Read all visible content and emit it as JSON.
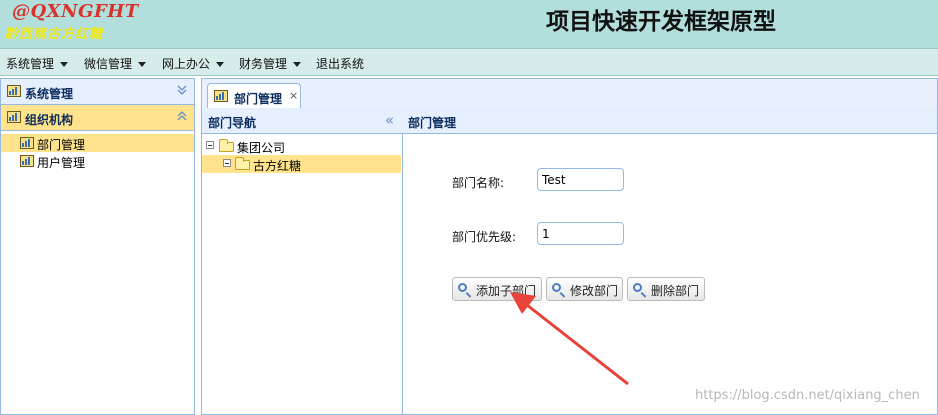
{
  "header": {
    "logo_line1": "@QXNGFHT",
    "logo_line2": "黔西南古方红糖",
    "title": "项目快速开发框架原型"
  },
  "menu": {
    "items": [
      {
        "label": "系统管理",
        "has_dropdown": true
      },
      {
        "label": "微信管理",
        "has_dropdown": true
      },
      {
        "label": "网上办公",
        "has_dropdown": true
      },
      {
        "label": "财务管理",
        "has_dropdown": true
      },
      {
        "label": "退出系统",
        "has_dropdown": false
      }
    ]
  },
  "sidebar": {
    "sections": [
      {
        "title": "系统管理",
        "expanded": false
      },
      {
        "title": "组织机构",
        "expanded": true
      }
    ],
    "items": [
      {
        "label": "部门管理",
        "selected": true
      },
      {
        "label": "用户管理",
        "selected": false
      }
    ]
  },
  "tabs": [
    {
      "label": "部门管理",
      "close": "×"
    }
  ],
  "nav": {
    "title": "部门导航",
    "collapse_glyph": "«",
    "tree": [
      {
        "label": "集团公司",
        "selected": false
      },
      {
        "label": "古方红糖",
        "selected": true
      }
    ]
  },
  "detail": {
    "title": "部门管理",
    "name_label": "部门名称:",
    "name_value": "Test",
    "priority_label": "部门优先级:",
    "priority_value": "1",
    "buttons": {
      "add": "添加子部门",
      "edit": "修改部门",
      "delete": "删除部门"
    }
  },
  "watermark": "https://blog.csdn.net/qixiang_chen",
  "colors": {
    "header_bg": "#b2dfdc",
    "selected_bg": "#ffe48d",
    "panel_border": "#95b8e7",
    "annotation_arrow": "#e8423b"
  }
}
